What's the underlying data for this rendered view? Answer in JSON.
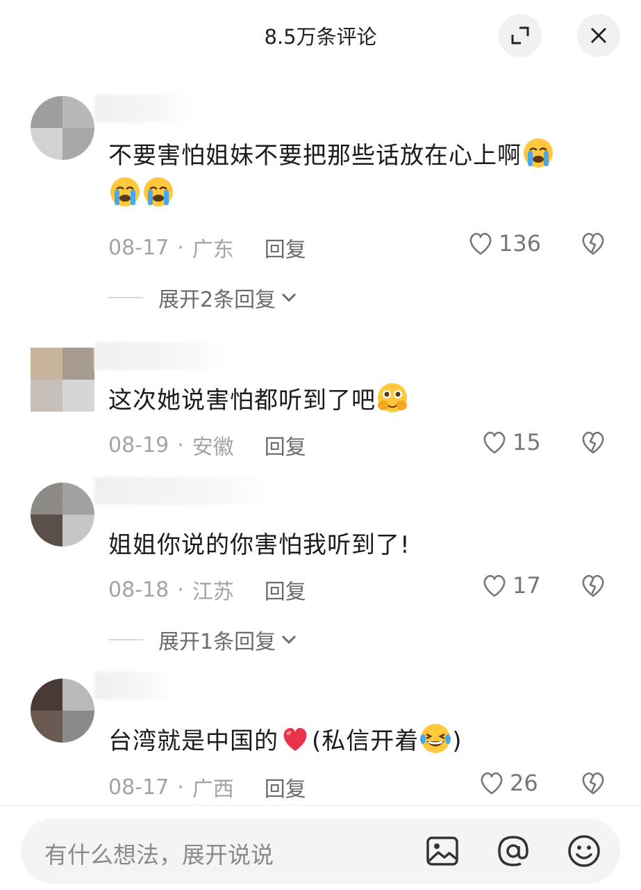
{
  "header": {
    "title": "8.5万条评论",
    "expand_icon": "expand-icon",
    "close_icon": "close-icon"
  },
  "comments": [
    {
      "text": "不要害怕姐妹不要把那些话放在心上啊",
      "emojis": [
        "loudly-crying-face",
        "loudly-crying-face",
        "loudly-crying-face"
      ],
      "date": "08-17",
      "location": "广东",
      "reply_label": "回复",
      "likes": "136",
      "expand_replies": "展开2条回复"
    },
    {
      "text": "这次她说害怕都听到了吧",
      "emojis": [
        "face-holding-back-tears"
      ],
      "date": "08-19",
      "location": "安徽",
      "reply_label": "回复",
      "likes": "15"
    },
    {
      "text": "姐姐你说的你害怕我听到了!",
      "date": "08-18",
      "location": "江苏",
      "reply_label": "回复",
      "likes": "17",
      "expand_replies": "展开1条回复"
    },
    {
      "text_before": "台湾就是中国的",
      "text_after": "(私信开着",
      "text_end": ")",
      "emojis": [
        "red-heart",
        "face-with-tears-of-joy"
      ],
      "date": "08-17",
      "location": "广西",
      "reply_label": "回复",
      "likes": "26"
    }
  ],
  "separator": "·",
  "input": {
    "placeholder": "有什么想法，展开说说",
    "icons": [
      "image-icon",
      "at-icon",
      "emoji-icon"
    ]
  },
  "colors": {
    "text": "#1b1b1b",
    "meta": "#a3a3a3",
    "reply": "#6b6b6b",
    "heart_red": "#e8334a",
    "emoji_yellow": "#ffc83d"
  }
}
